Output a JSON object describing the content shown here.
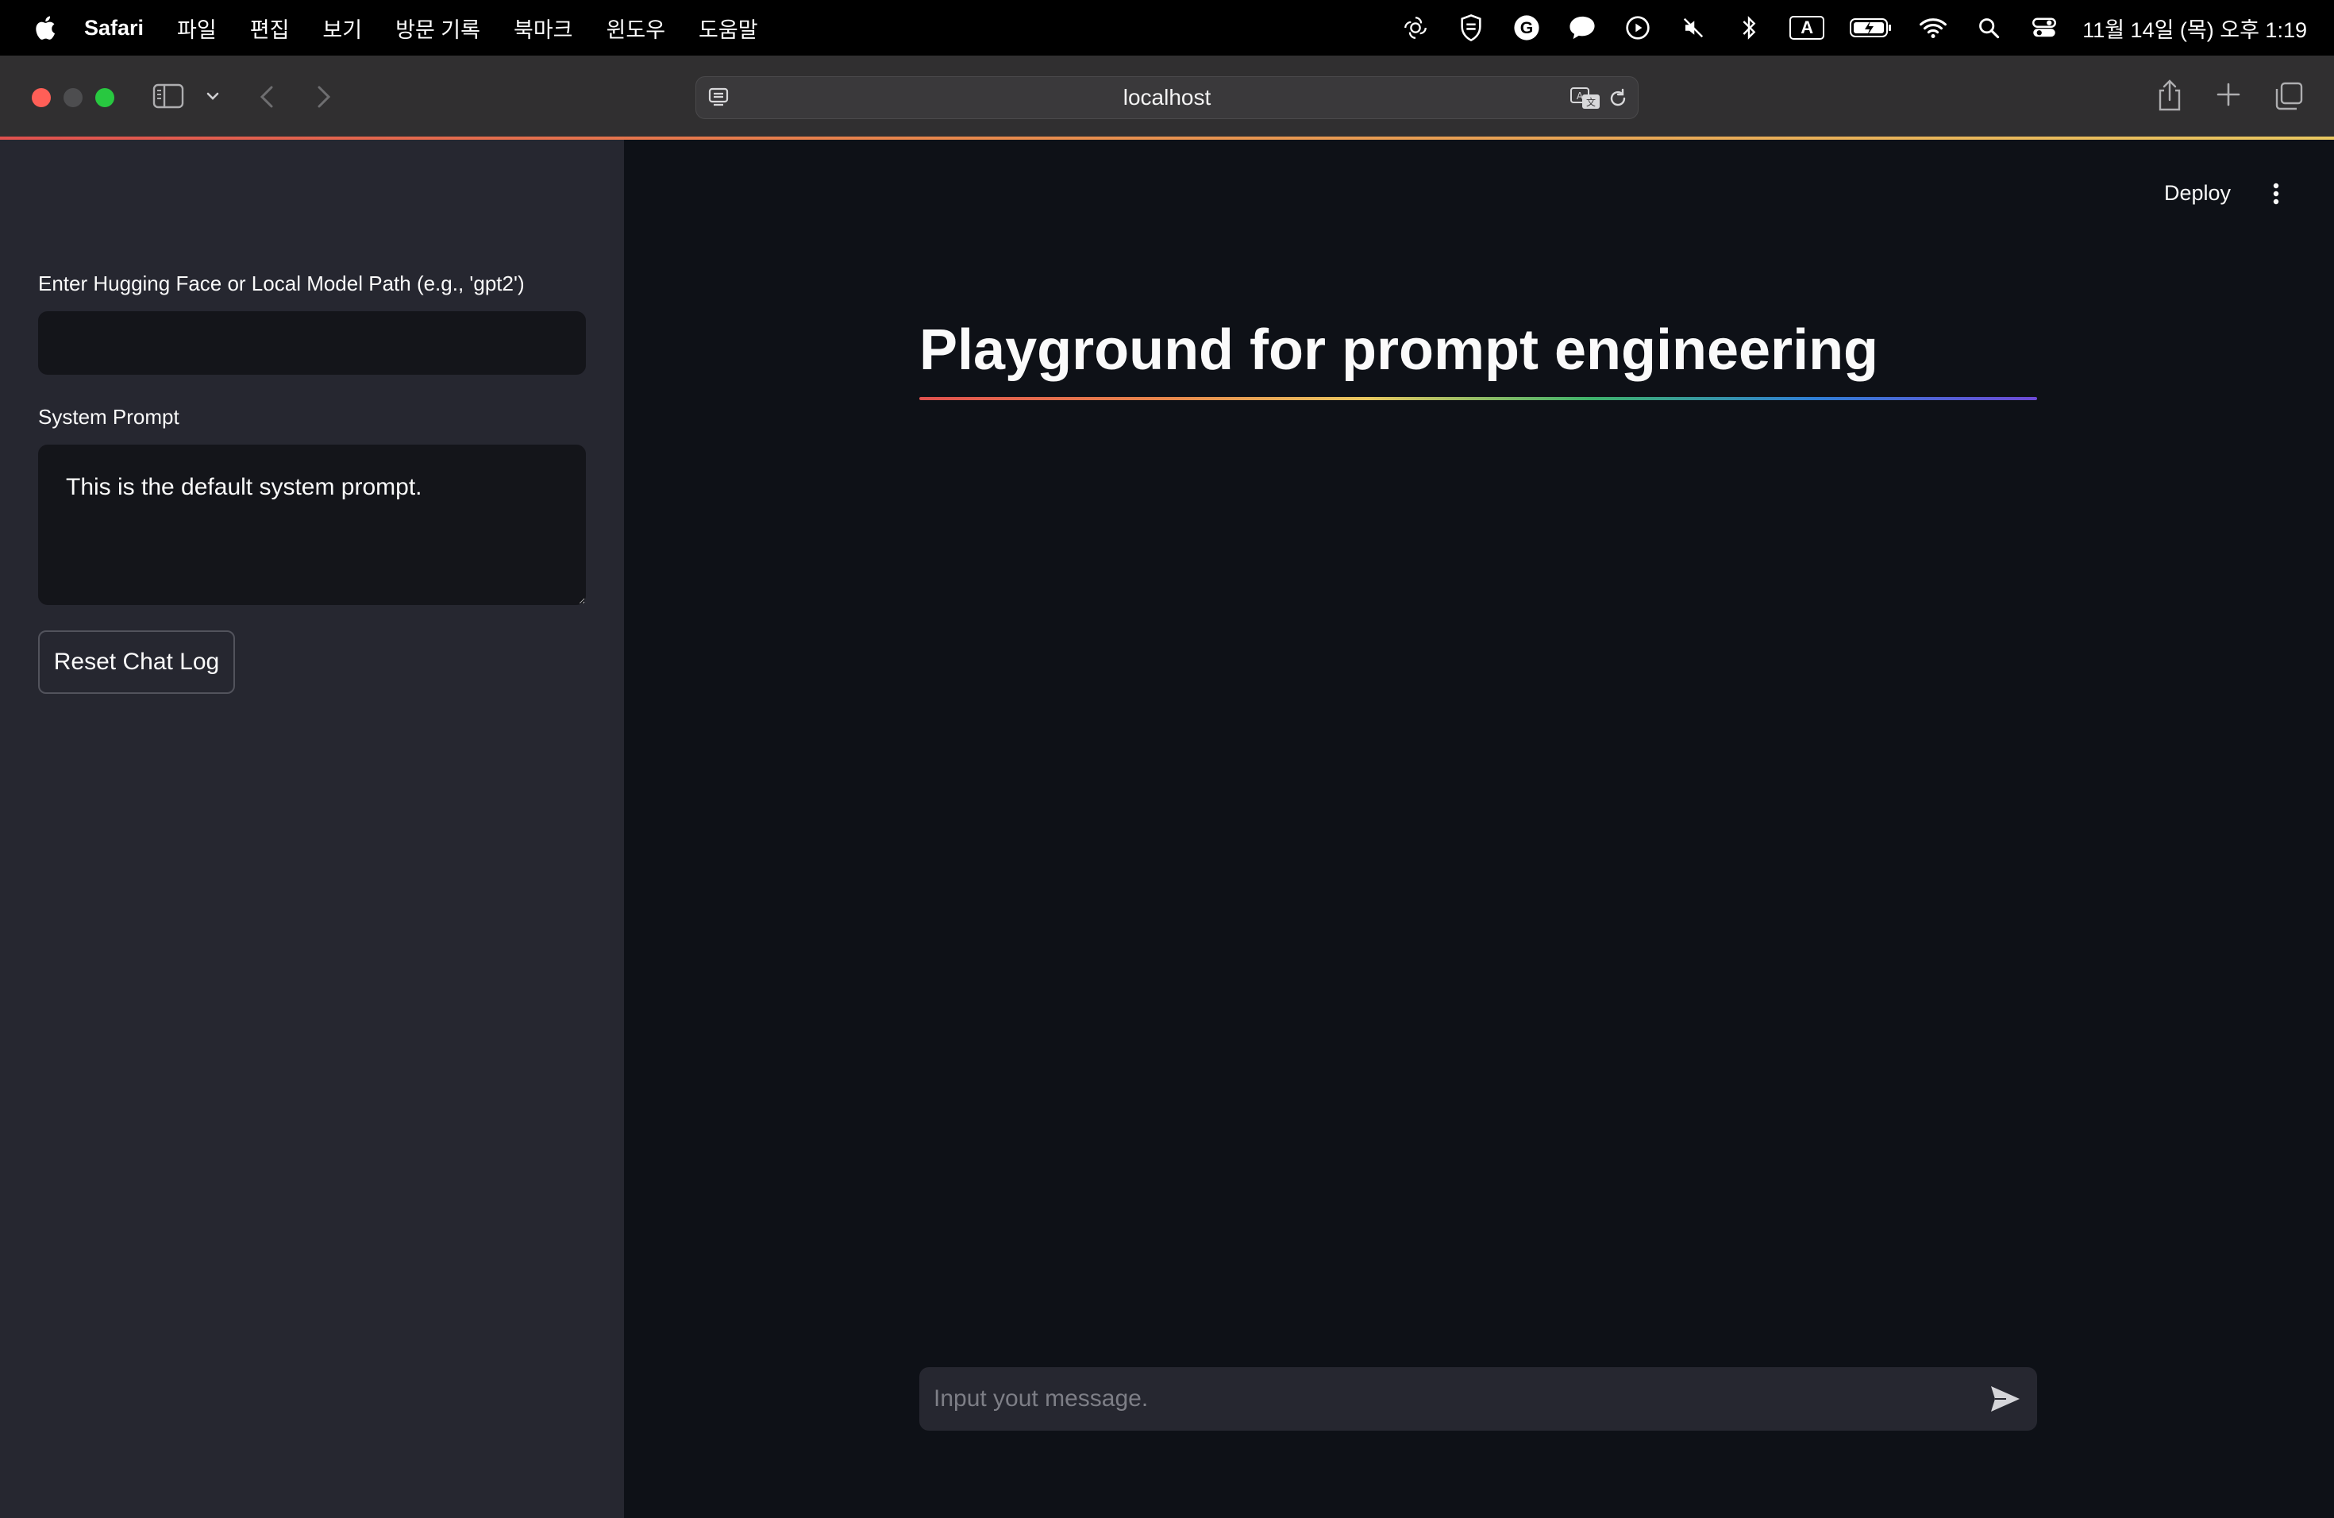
{
  "menubar": {
    "app_name": "Safari",
    "menus": [
      "파일",
      "편집",
      "보기",
      "방문 기록",
      "북마크",
      "윈도우",
      "도움말"
    ],
    "status_icons": [
      "chatgpt-icon",
      "shield-icon",
      "grammarly-icon",
      "chat-bubble-icon",
      "play-icon",
      "mute-icon",
      "bluetooth-icon",
      "input-source-icon",
      "battery-icon",
      "wifi-icon",
      "spotlight-icon",
      "control-center-icon"
    ],
    "input_source": "A",
    "clock": "11월 14일 (목) 오후 1:19"
  },
  "browser": {
    "url": "localhost",
    "traffic_colors": [
      "#ff5f57",
      "#4d4d4f",
      "#28c840"
    ]
  },
  "sidebar": {
    "model_path": {
      "label": "Enter Hugging Face or Local Model Path (e.g., 'gpt2')",
      "value": ""
    },
    "system_prompt": {
      "label": "System Prompt",
      "value": "This is the default system prompt."
    },
    "reset_button": "Reset Chat Log"
  },
  "main": {
    "deploy_label": "Deploy",
    "title": "Playground for prompt engineering",
    "chat_input": {
      "placeholder": "Input yout message.",
      "value": ""
    }
  }
}
